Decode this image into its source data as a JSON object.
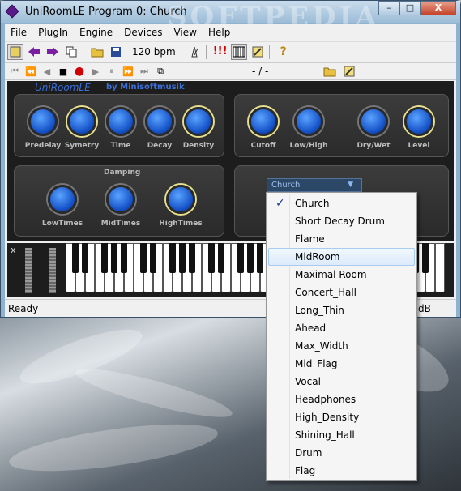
{
  "window": {
    "title": "UniRoomLE Program 0: Church",
    "min_label": "–",
    "max_label": "□",
    "close_label": "X"
  },
  "menu": [
    "File",
    "PlugIn",
    "Engine",
    "Devices",
    "View",
    "Help"
  ],
  "toolbar": {
    "tempo": "120 bpm",
    "warn_label": "!!!",
    "help_label": "?"
  },
  "transport": {
    "position": "- / -"
  },
  "plugin": {
    "name": "UniRoomLE",
    "by": "by Minisoftmusik",
    "knobs_left": [
      "Predelay",
      "Symetry",
      "Time",
      "Decay",
      "Density"
    ],
    "knobs_right": [
      "Cutoff",
      "Low/High",
      "Dry/Wet",
      "Level"
    ],
    "damping_title": "Damping",
    "damping_knobs": [
      "LowTimes",
      "MidTimes",
      "HighTimes"
    ],
    "preset_selected": "Church"
  },
  "keyboard": {
    "close_label": "x"
  },
  "status": {
    "text": "Ready",
    "db": "dB"
  },
  "watermark": "SOFTPEDIA",
  "dropdown": {
    "items": [
      "Church",
      "Short Decay Drum",
      "Flame",
      "MidRoom",
      "Maximal Room",
      "Concert_Hall",
      "Long_Thin",
      "Ahead",
      "Max_Width",
      "Mid_Flag",
      "Vocal",
      "Headphones",
      "High_Density",
      "Shining_Hall",
      "Drum",
      "Flag"
    ],
    "checked_index": 0,
    "hover_index": 3
  }
}
